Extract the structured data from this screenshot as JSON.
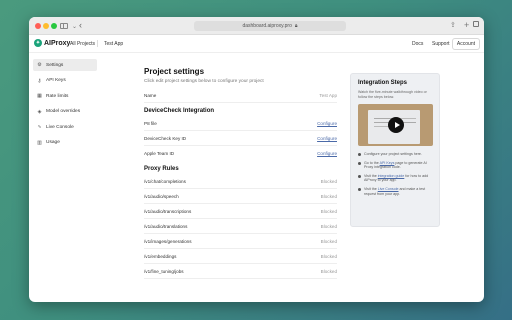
{
  "browser": {
    "url": "dashboard.aiproxy.pro",
    "lock_icon": "lock-icon"
  },
  "nav": {
    "logo_text": "AIProxy",
    "all_projects": "All Projects",
    "project_name": "Test App",
    "docs": "Docs",
    "support": "Support",
    "account": "Account"
  },
  "sidebar": {
    "items": [
      {
        "label": "Settings",
        "icon": "gear-icon",
        "active": true
      },
      {
        "label": "API Keys",
        "icon": "key-icon"
      },
      {
        "label": "Rate limits",
        "icon": "grid-icon"
      },
      {
        "label": "Model overrides",
        "icon": "layers-icon"
      },
      {
        "label": "Live Console",
        "icon": "pulse-icon"
      },
      {
        "label": "Usage",
        "icon": "chart-icon"
      }
    ]
  },
  "main": {
    "title": "Project settings",
    "subtitle": "Click edit project settings below to configure your project",
    "name_label": "Name",
    "name_value": "Test App",
    "devicecheck": {
      "title": "DeviceCheck Integration",
      "rows": [
        {
          "label": "P8 file",
          "action": "Configure"
        },
        {
          "label": "DeviceCheck Key ID",
          "action": "Configure"
        },
        {
          "label": "Apple Team ID",
          "action": "Configure"
        }
      ]
    },
    "proxy_rules": {
      "title": "Proxy Rules",
      "rows": [
        {
          "path": "/v1/chat/completions",
          "status": "Blocked"
        },
        {
          "path": "/v1/audio/speech",
          "status": "Blocked"
        },
        {
          "path": "/v1/audio/transcriptions",
          "status": "Blocked"
        },
        {
          "path": "/v1/audio/translations",
          "status": "Blocked"
        },
        {
          "path": "/v1/images/generations",
          "status": "Blocked"
        },
        {
          "path": "/v1/embeddings",
          "status": "Blocked"
        },
        {
          "path": "/v1/fine_tuning/jobs",
          "status": "Blocked"
        }
      ]
    }
  },
  "panel": {
    "title": "Integration Steps",
    "desc": "Watch the five-minute walkthrough video or follow the steps below.",
    "steps": [
      {
        "pre": "Configure your project settings here.",
        "link": "",
        "post": ""
      },
      {
        "pre": "Go to the ",
        "link": "API Keys",
        "post": " page to generate AI Proxy integration code."
      },
      {
        "pre": "Visit the ",
        "link": "integration guide",
        "post": " for how to add AIProxy to your app."
      },
      {
        "pre": "Visit the ",
        "link": "Live Console",
        "post": " and make a test request from your app."
      }
    ]
  },
  "colors": {
    "brand": "#1aa37a",
    "link": "#4b6aa8"
  }
}
